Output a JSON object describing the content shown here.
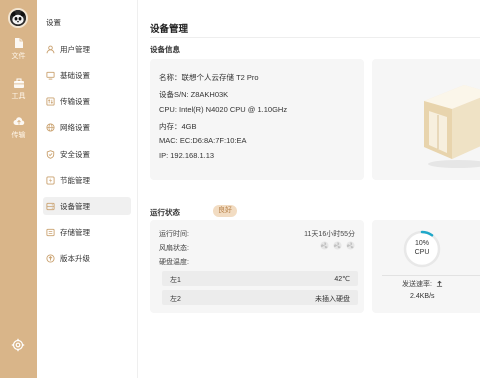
{
  "rail": {
    "items": [
      {
        "label": "文件",
        "icon": "file-icon"
      },
      {
        "label": "工具",
        "icon": "toolbox-icon"
      },
      {
        "label": "传输",
        "icon": "cloud-transfer-icon"
      }
    ],
    "settings_icon": "gear-icon"
  },
  "menu": {
    "title": "设置",
    "items": [
      {
        "label": "用户管理",
        "icon": "user-icon",
        "active": false
      },
      {
        "label": "基础设置",
        "icon": "monitor-icon",
        "active": false
      },
      {
        "label": "传输设置",
        "icon": "transfer-icon",
        "active": false
      },
      {
        "label": "网络设置",
        "icon": "globe-icon",
        "active": false
      },
      {
        "label": "安全设置",
        "icon": "shield-icon",
        "active": false
      },
      {
        "label": "节能管理",
        "icon": "lightning-icon",
        "active": false
      },
      {
        "label": "设备管理",
        "icon": "device-icon",
        "active": true
      },
      {
        "label": "存储管理",
        "icon": "storage-icon",
        "active": false
      },
      {
        "label": "版本升级",
        "icon": "upgrade-icon",
        "active": false
      }
    ]
  },
  "main": {
    "page_title": "设备管理",
    "device_info": {
      "title": "设备信息",
      "lines": [
        "名称：联想个人云存储 T2 Pro",
        "设备S/N:  Z8AKH03K",
        "CPU:  Intel(R) N4020 CPU @ 1.10GHz",
        "内存：4GB",
        "MAC:  EC:D6:8A:7F:10:EA",
        "IP:  192.168.1.13"
      ]
    },
    "status": {
      "title": "运行状态",
      "badge": "良好",
      "uptime_label": "运行时间:",
      "uptime_value": "11天16小时55分",
      "fan_label": "风扇状态:",
      "disk_temp_label": "硬盘温度:",
      "disks": [
        {
          "name": "左1",
          "value": "42℃"
        },
        {
          "name": "左2",
          "value": "未插入硬盘"
        }
      ]
    },
    "cpu": {
      "percent_text": "10%",
      "label": "CPU",
      "usage_fraction": 0.1,
      "send_label": "发送速率:",
      "send_value": "2.4KB/s"
    }
  },
  "colors": {
    "rail": "#d9b589",
    "accent": "#1fa8c9",
    "badge_bg": "#f2dcc2",
    "badge_fg": "#b8824a"
  }
}
